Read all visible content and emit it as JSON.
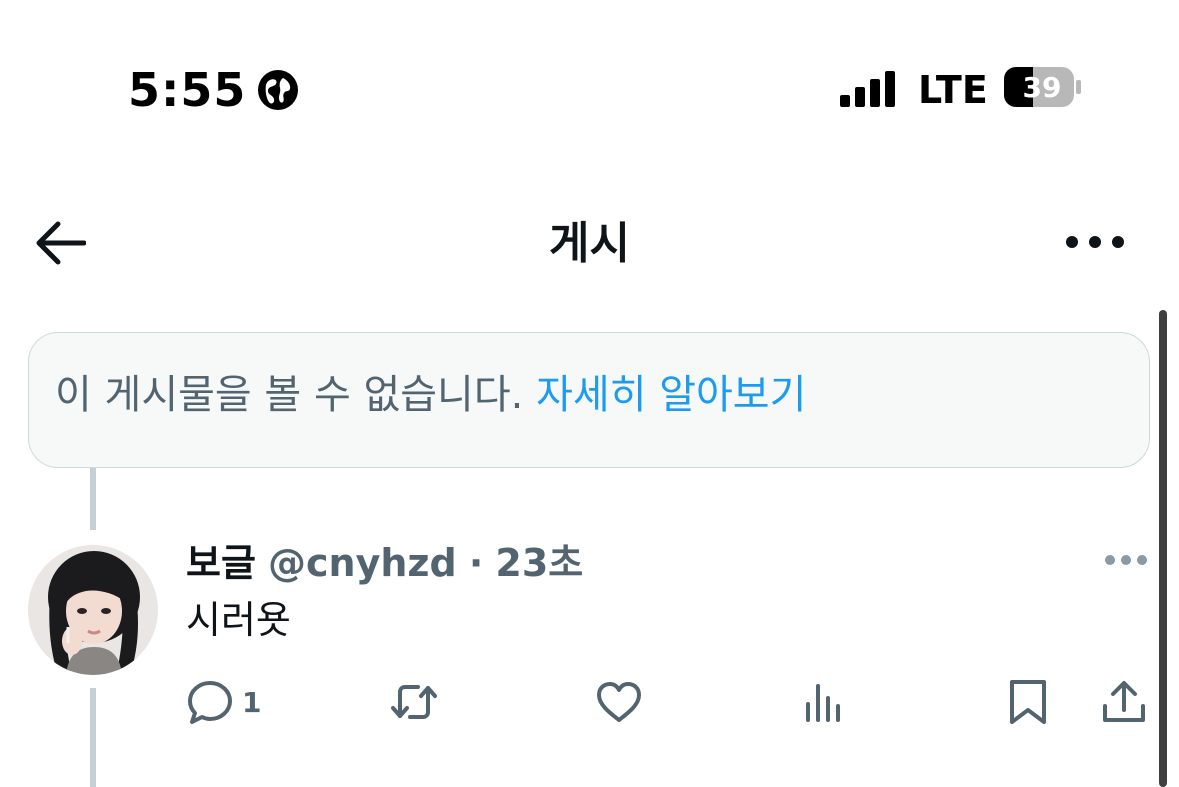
{
  "status_bar": {
    "time": "5:55",
    "network": "LTE",
    "battery": "39"
  },
  "nav": {
    "title": "게시"
  },
  "notice": {
    "message": "이 게시물을 볼 수 없습니다.",
    "link": "자세히 알아보기"
  },
  "tweet": {
    "name": "보글",
    "handle": "@cnyhzd",
    "separator": "·",
    "time": "23초",
    "text": "시러욧",
    "reply_count": "1"
  },
  "icons": {
    "status": [
      "globe-icon",
      "signal-icon",
      "battery-icon"
    ],
    "nav": [
      "back-arrow-icon",
      "more-icon"
    ],
    "actions": [
      "reply-icon",
      "retweet-icon",
      "like-icon",
      "views-icon",
      "bookmark-icon",
      "share-icon"
    ]
  },
  "colors": {
    "link": "#1d9bf0",
    "secondary_text": "#536471",
    "notice_bg": "#f7f9f9",
    "border": "#cfd9de"
  }
}
